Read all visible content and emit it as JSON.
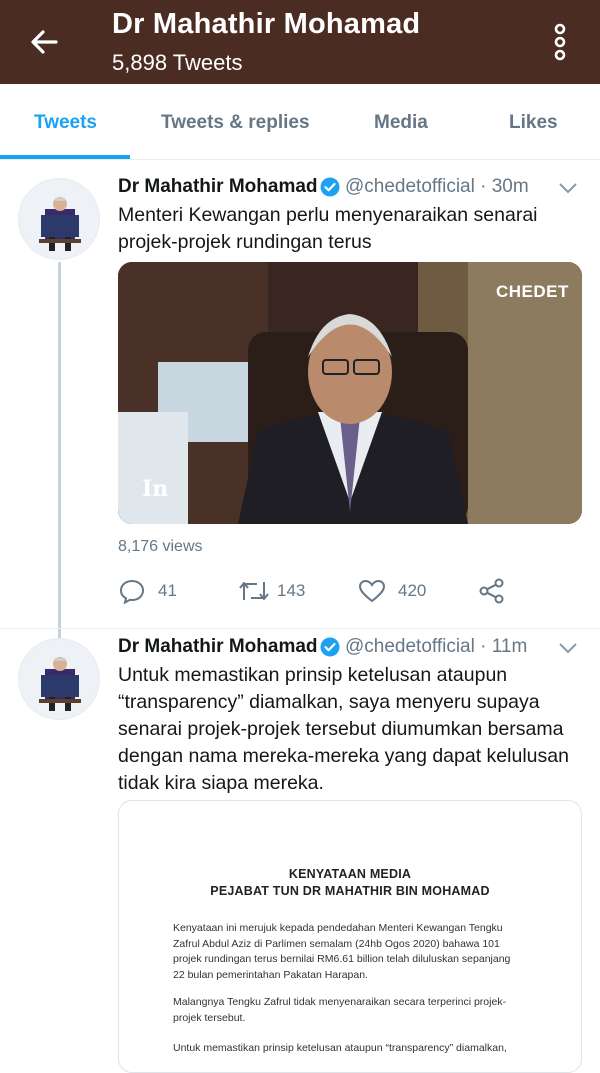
{
  "header": {
    "title": "Dr Mahathir Mohamad",
    "tweet_count": "5,898 Tweets"
  },
  "tabs": [
    {
      "label": "Tweets",
      "active": true
    },
    {
      "label": "Tweets & replies",
      "active": false
    },
    {
      "label": "Media",
      "active": false
    },
    {
      "label": "Likes",
      "active": false
    }
  ],
  "tweets": [
    {
      "name": "Dr Mahathir Mohamad",
      "handle_time": "@chedetofficial · 30m",
      "text_lines": [
        "Menteri Kewangan perlu menyenaraikan senarai",
        "projek-projek rundingan terus"
      ],
      "video_watermark": "CHEDET",
      "video_logo": "In",
      "views": "8,176 views",
      "replies": "41",
      "retweets": "143",
      "likes": "420"
    },
    {
      "name": "Dr Mahathir Mohamad",
      "handle_time": "@chedetofficial · 11m",
      "text_lines": [
        "Untuk memastikan prinsip ketelusan ataupun",
        "“transparency” diamalkan, saya menyeru supaya",
        "senarai projek-projek tersebut diumumkan bersama",
        "dengan nama mereka-mereka yang dapat kelulusan",
        "tidak kira siapa mereka."
      ],
      "document": {
        "heading1": "KENYATAAN MEDIA",
        "heading2": "PEJABAT TUN DR MAHATHIR BIN MOHAMAD",
        "para1_lines": [
          "Kenyataan ini merujuk kepada pendedahan Menteri Kewangan Tengku",
          "Zafrul Abdul Aziz di Parlimen semalam (24hb Ogos 2020) bahawa 101",
          "projek rundingan terus bernilai RM6.61 billion telah diluluskan sepanjang",
          "22 bulan pemerintahan Pakatan Harapan."
        ],
        "para2_lines": [
          "Malangnya Tengku Zafrul tidak menyenaraikan secara terperinci projek-",
          "projek tersebut."
        ],
        "para3_lines": [
          "Untuk memastikan prinsip ketelusan ataupun “transparency” diamalkan,"
        ]
      }
    }
  ],
  "colors": {
    "header_bg": "#4a2c22",
    "accent": "#1da1f2",
    "verified": "#1da1f2",
    "muted": "#657786"
  }
}
